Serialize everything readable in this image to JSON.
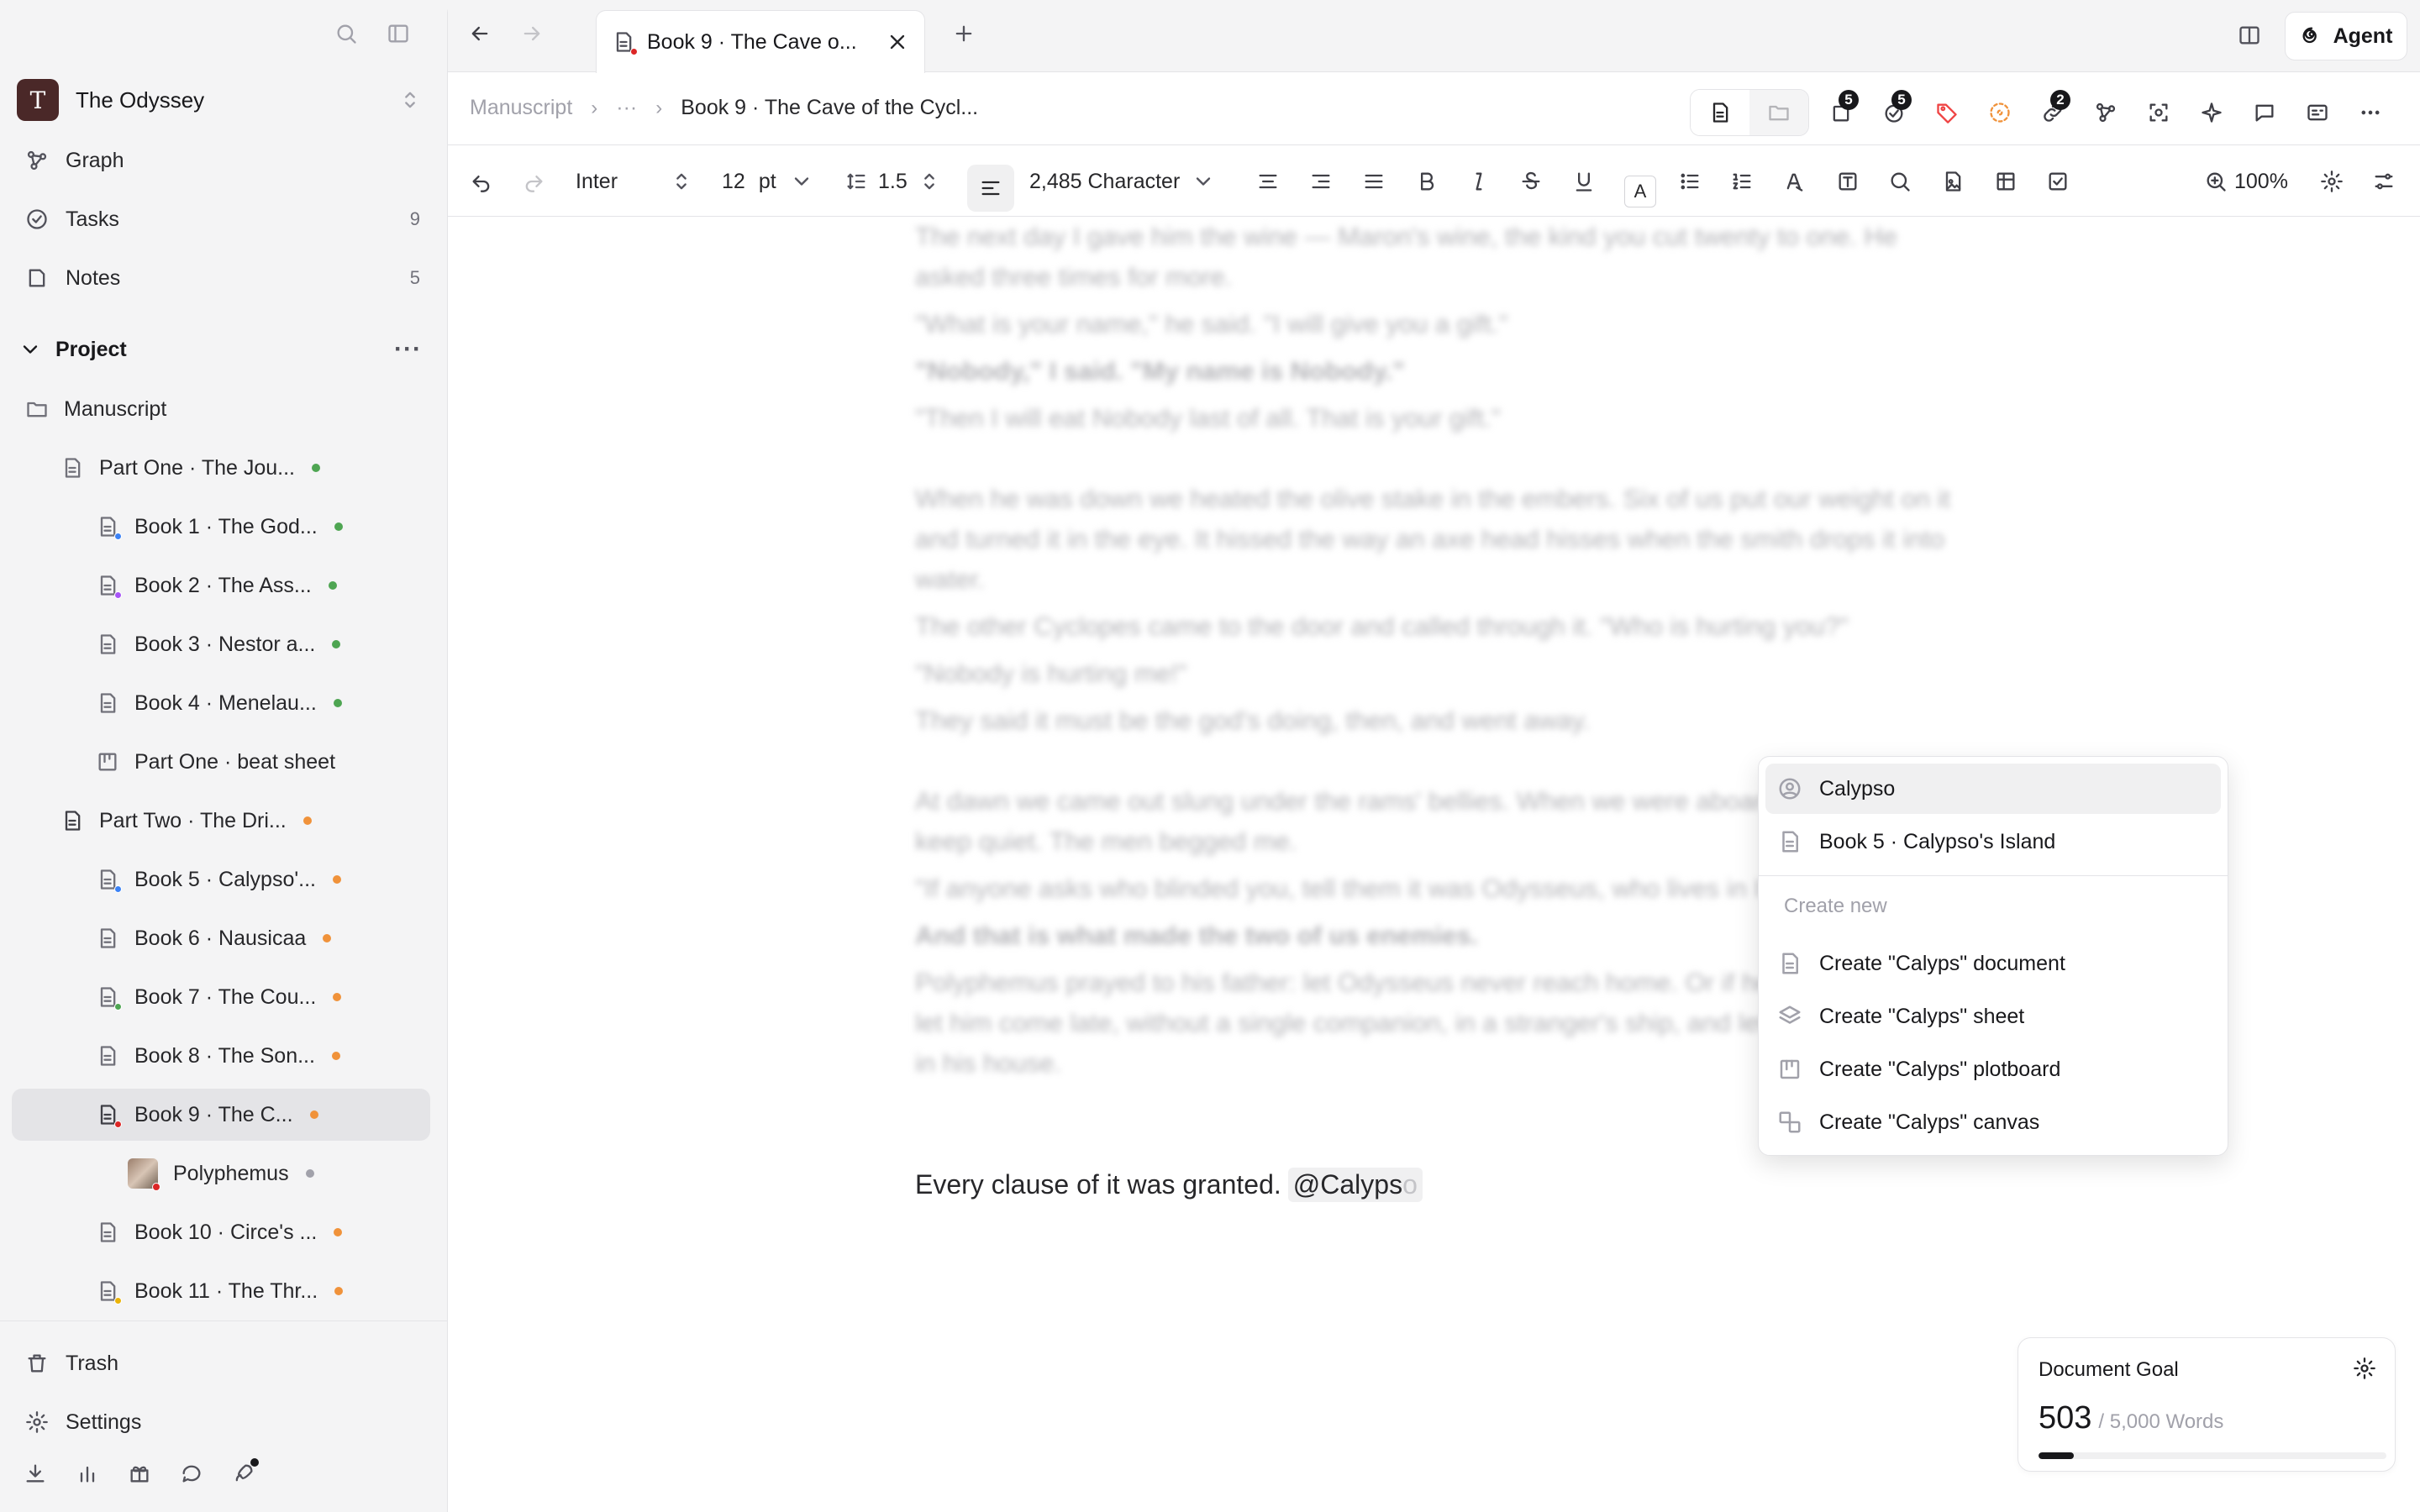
{
  "workspace": {
    "initial": "T",
    "name": "The Odyssey"
  },
  "nav": {
    "graph": "Graph",
    "tasks": {
      "label": "Tasks",
      "count": "9"
    },
    "notes": {
      "label": "Notes",
      "count": "5"
    }
  },
  "project": {
    "label": "Project"
  },
  "tree": [
    {
      "label": "Manuscript"
    },
    {
      "label": "Part One · The Jou..."
    },
    {
      "label": "Book 1 · The God..."
    },
    {
      "label": "Book 2 · The Ass..."
    },
    {
      "label": "Book 3 · Nestor a..."
    },
    {
      "label": "Book 4 · Menelau..."
    },
    {
      "label": "Part One · beat sheet"
    },
    {
      "label": "Part Two · The Dri..."
    },
    {
      "label": "Book 5 · Calypso'..."
    },
    {
      "label": "Book 6 · Nausicaa"
    },
    {
      "label": "Book 7 · The Cou..."
    },
    {
      "label": "Book 8 · The Son..."
    },
    {
      "label": "Book 9 · The C..."
    },
    {
      "label": "Polyphemus"
    },
    {
      "label": "Book 10 · Circe's ..."
    },
    {
      "label": "Book 11 · The Thr..."
    }
  ],
  "footer": {
    "trash": "Trash",
    "settings": "Settings"
  },
  "tab": {
    "title": "Book 9 · The Cave o..."
  },
  "agent": {
    "label": "Agent"
  },
  "breadcrumb": {
    "root": "Manuscript",
    "ellipsis": "···",
    "current": "Book 9 · The Cave of the Cycl..."
  },
  "badges": {
    "outline": "5",
    "tasks": "5",
    "links": "2"
  },
  "format": {
    "font": "Inter",
    "size": "12",
    "unit": "pt",
    "line_height": "1.5",
    "count": "2,485 Character",
    "color_glyph": "A",
    "zoom": "100%"
  },
  "editor": {
    "paragraphs": [
      {
        "text": "The next day I gave him the wine — Maron's wine, the kind you cut twenty to one. He asked three times for more.",
        "bold": false,
        "gap": false
      },
      {
        "text": "\"What is your name,\" he said. \"I will give you a gift.\"",
        "bold": false,
        "gap": false
      },
      {
        "text": "\"Nobody,\" I said. \"My name is Nobody.\"",
        "bold": true,
        "gap": false
      },
      {
        "text": "\"Then I will eat Nobody last of all. That is your gift.\"",
        "bold": false,
        "gap": false
      },
      {
        "text": "When he was down we heated the olive stake in the embers. Six of us put our weight on it and turned it in the eye. It hissed the way an axe head hisses when the smith drops it into water.",
        "bold": false,
        "gap": true
      },
      {
        "text": "The other Cyclopes came to the door and called through it. \"Who is hurting you?\"",
        "bold": false,
        "gap": false
      },
      {
        "text": "\"Nobody is hurting me!\"",
        "bold": false,
        "gap": false
      },
      {
        "text": "They said it must be the god's doing, then, and went away.",
        "bold": false,
        "gap": false
      },
      {
        "text": "At dawn we came out slung under the rams' bellies. When we were aboard I could not keep quiet. The men begged me.",
        "bold": false,
        "gap": true
      },
      {
        "text": "\"If anyone asks who blinded you, tell them it was Odysseus, who lives in Ithaca.\"",
        "bold": false,
        "gap": false
      },
      {
        "text": "And that is what made the two of us enemies.",
        "bold": true,
        "gap": false
      },
      {
        "text": "Polyphemus prayed to his father: let Odysseus never reach home. Or if he must reach it, let him come late, without a single companion, in a stranger's ship, and let him find trouble in his house.",
        "bold": false,
        "gap": false
      }
    ],
    "live_line": "Every clause of it was granted.",
    "mention": "@Calyps",
    "mention_ghost": "o"
  },
  "popup": {
    "items": [
      {
        "label": "Calypso",
        "icon": "person-icon"
      },
      {
        "label": "Book 5 · Calypso's Island",
        "icon": "document-icon"
      }
    ],
    "create_header": "Create new",
    "create": [
      {
        "label": "Create \"Calyps\" document",
        "icon": "document-icon"
      },
      {
        "label": "Create \"Calyps\" sheet",
        "icon": "layers-icon"
      },
      {
        "label": "Create \"Calyps\" plotboard",
        "icon": "plotboard-icon"
      },
      {
        "label": "Create \"Calyps\" canvas",
        "icon": "canvas-icon"
      }
    ]
  },
  "goal": {
    "title": "Document Goal",
    "value": "503",
    "total": "/ 5,000 Words",
    "progress": 0.1006
  },
  "colors": {
    "green": "#4ea552",
    "orange": "#f0923a",
    "gray": "#a1a1aa",
    "blue": "#3b82f6",
    "purple": "#a855f7",
    "red": "#dc2626",
    "yellow": "#eab308"
  }
}
